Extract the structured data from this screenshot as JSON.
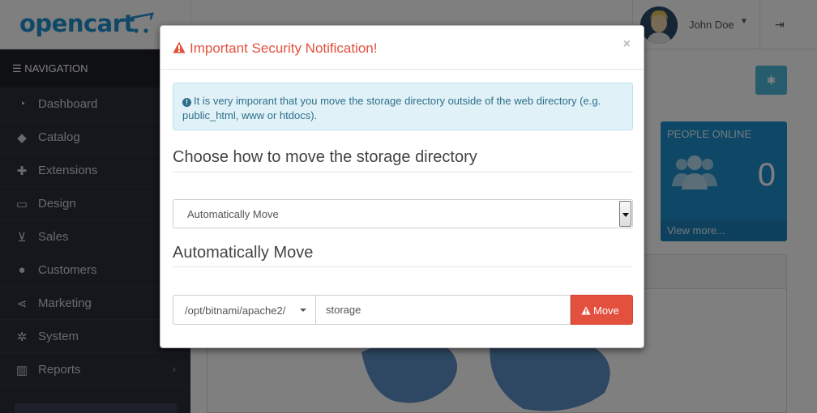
{
  "header": {
    "logo_text": "opencart",
    "user_name": "John Doe",
    "logout_icon": "sign-out-icon"
  },
  "sidebar": {
    "heading": "NAVIGATION",
    "items": [
      {
        "label": "Dashboard",
        "icon": "dashboard-icon"
      },
      {
        "label": "Catalog",
        "icon": "tags-icon"
      },
      {
        "label": "Extensions",
        "icon": "puzzle-icon"
      },
      {
        "label": "Design",
        "icon": "monitor-icon"
      },
      {
        "label": "Sales",
        "icon": "cart-icon"
      },
      {
        "label": "Customers",
        "icon": "user-icon"
      },
      {
        "label": "Marketing",
        "icon": "share-icon"
      },
      {
        "label": "System",
        "icon": "gear-icon"
      },
      {
        "label": "Reports",
        "icon": "bar-chart-icon"
      }
    ]
  },
  "dashboard": {
    "people_online": {
      "title": "PEOPLE ONLINE",
      "count": "0",
      "link": "View more..."
    }
  },
  "modal": {
    "title": "Important Security Notification!",
    "close": "×",
    "alert_text": "It is very imporant that you move the storage directory outside of the web directory (e.g. public_html, www or htdocs).",
    "choose_heading": "Choose how to move the storage directory",
    "select_value": "Automatically Move",
    "auto_heading": "Automatically Move",
    "path_prefix": "/opt/bitnami/apache2/",
    "directory_value": "storage",
    "move_label": "Move"
  },
  "colors": {
    "brand": "#1e91cf",
    "danger": "#e3503e",
    "info_bg": "#e0f1f8",
    "sidebar": "#2b2f3a"
  }
}
